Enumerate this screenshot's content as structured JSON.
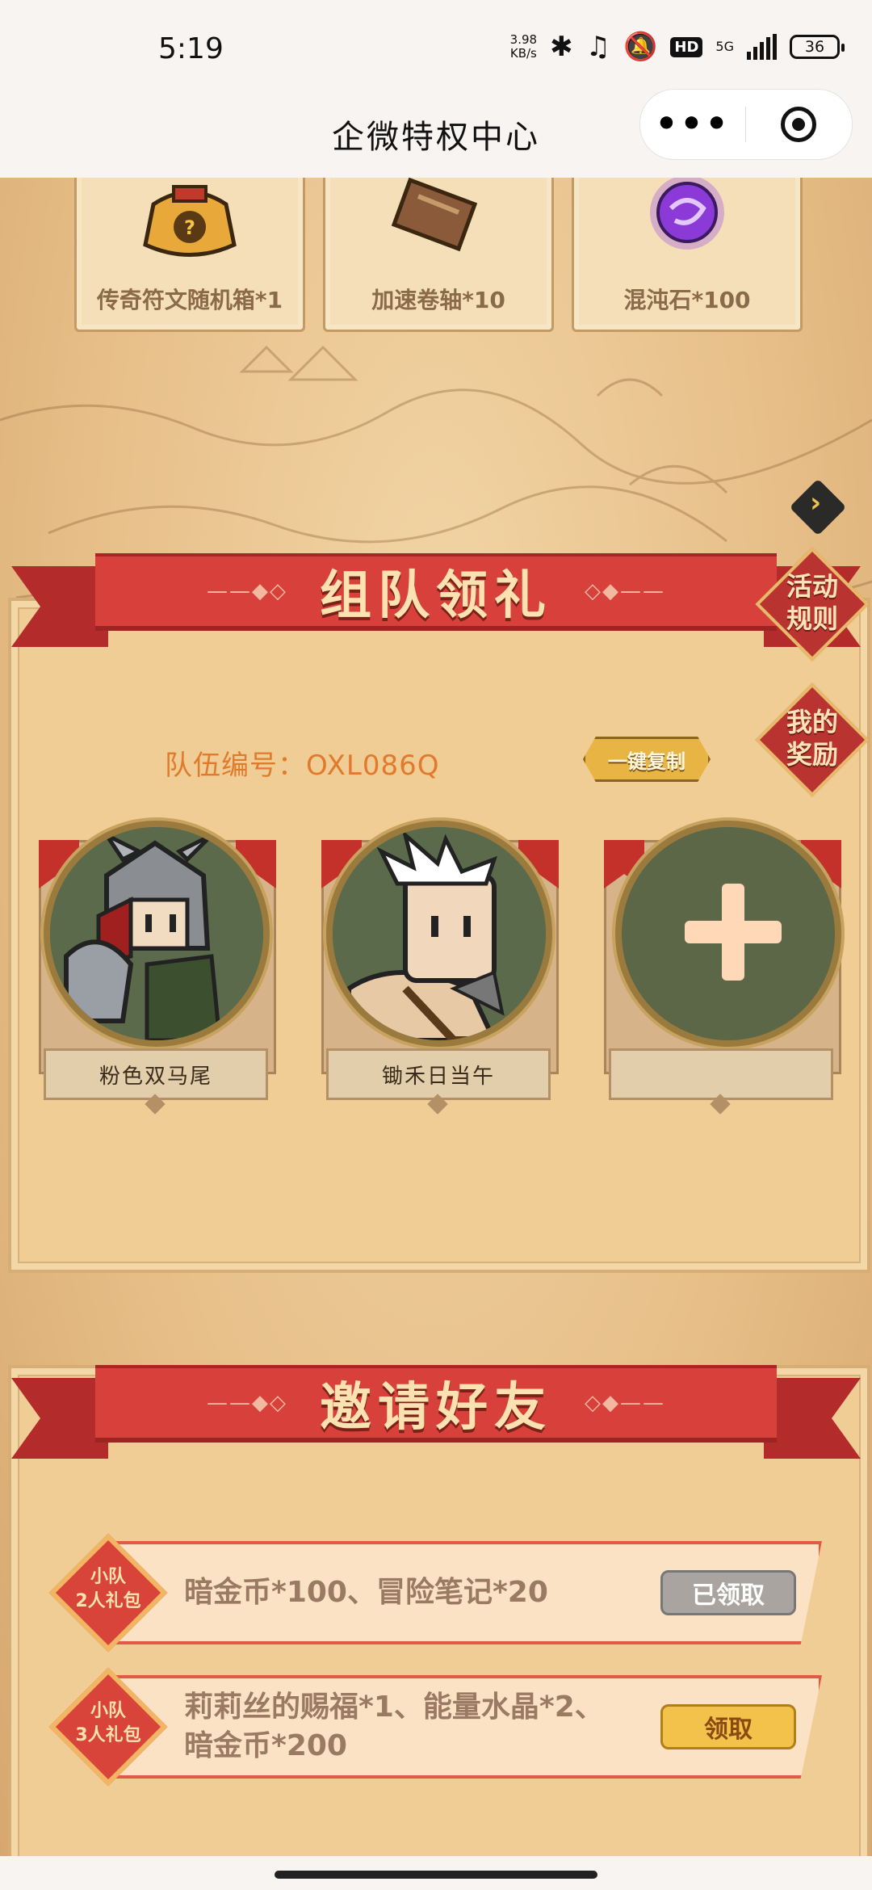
{
  "status_bar": {
    "time": "5:19",
    "net_speed_value": "3.98",
    "net_speed_unit": "KB/s",
    "network": "5G",
    "hd": "HD",
    "battery": "36",
    "icons": [
      "bluetooth-icon",
      "headphones-icon",
      "mute-icon"
    ]
  },
  "title_bar": {
    "title": "企微特权中心",
    "more_label": "•••"
  },
  "top_rewards": [
    {
      "label": "传奇符文随机箱*1",
      "icon": "rune-bag-icon"
    },
    {
      "label": "加速卷轴*10",
      "icon": "scroll-icon"
    },
    {
      "label": "混沌石*100",
      "icon": "chaos-stone-icon"
    }
  ],
  "team_section": {
    "title": "组队领礼",
    "rules_label": "活动\n规则",
    "my_rewards_label": "我的\n奖励",
    "team_id_text": "队伍编号：OXL086Q",
    "copy_label": "一键复制",
    "members": [
      {
        "name": "粉色双马尾",
        "avatar": "knight-avatar"
      },
      {
        "name": "锄禾日当午",
        "avatar": "white-hair-avatar"
      },
      {
        "name": "",
        "avatar": "add-member-plus-icon"
      }
    ]
  },
  "invite_section": {
    "title": "邀请好友",
    "rows": [
      {
        "badge": "小队\n2人礼包",
        "reward": "暗金币*100、冒险笔记*20",
        "button": "已领取",
        "claimed": true
      },
      {
        "badge": "小队\n3人礼包",
        "reward": "莉莉丝的赐福*1、能量水晶*2、\n暗金币*200",
        "button": "领取",
        "claimed": false
      }
    ]
  },
  "colors": {
    "ribbon_red": "#d8413b",
    "panel_bg": "#f0cd95",
    "team_id_orange": "#e07a2c",
    "claim_yellow": "#f3c24a",
    "claimed_gray": "#a9a49f"
  }
}
